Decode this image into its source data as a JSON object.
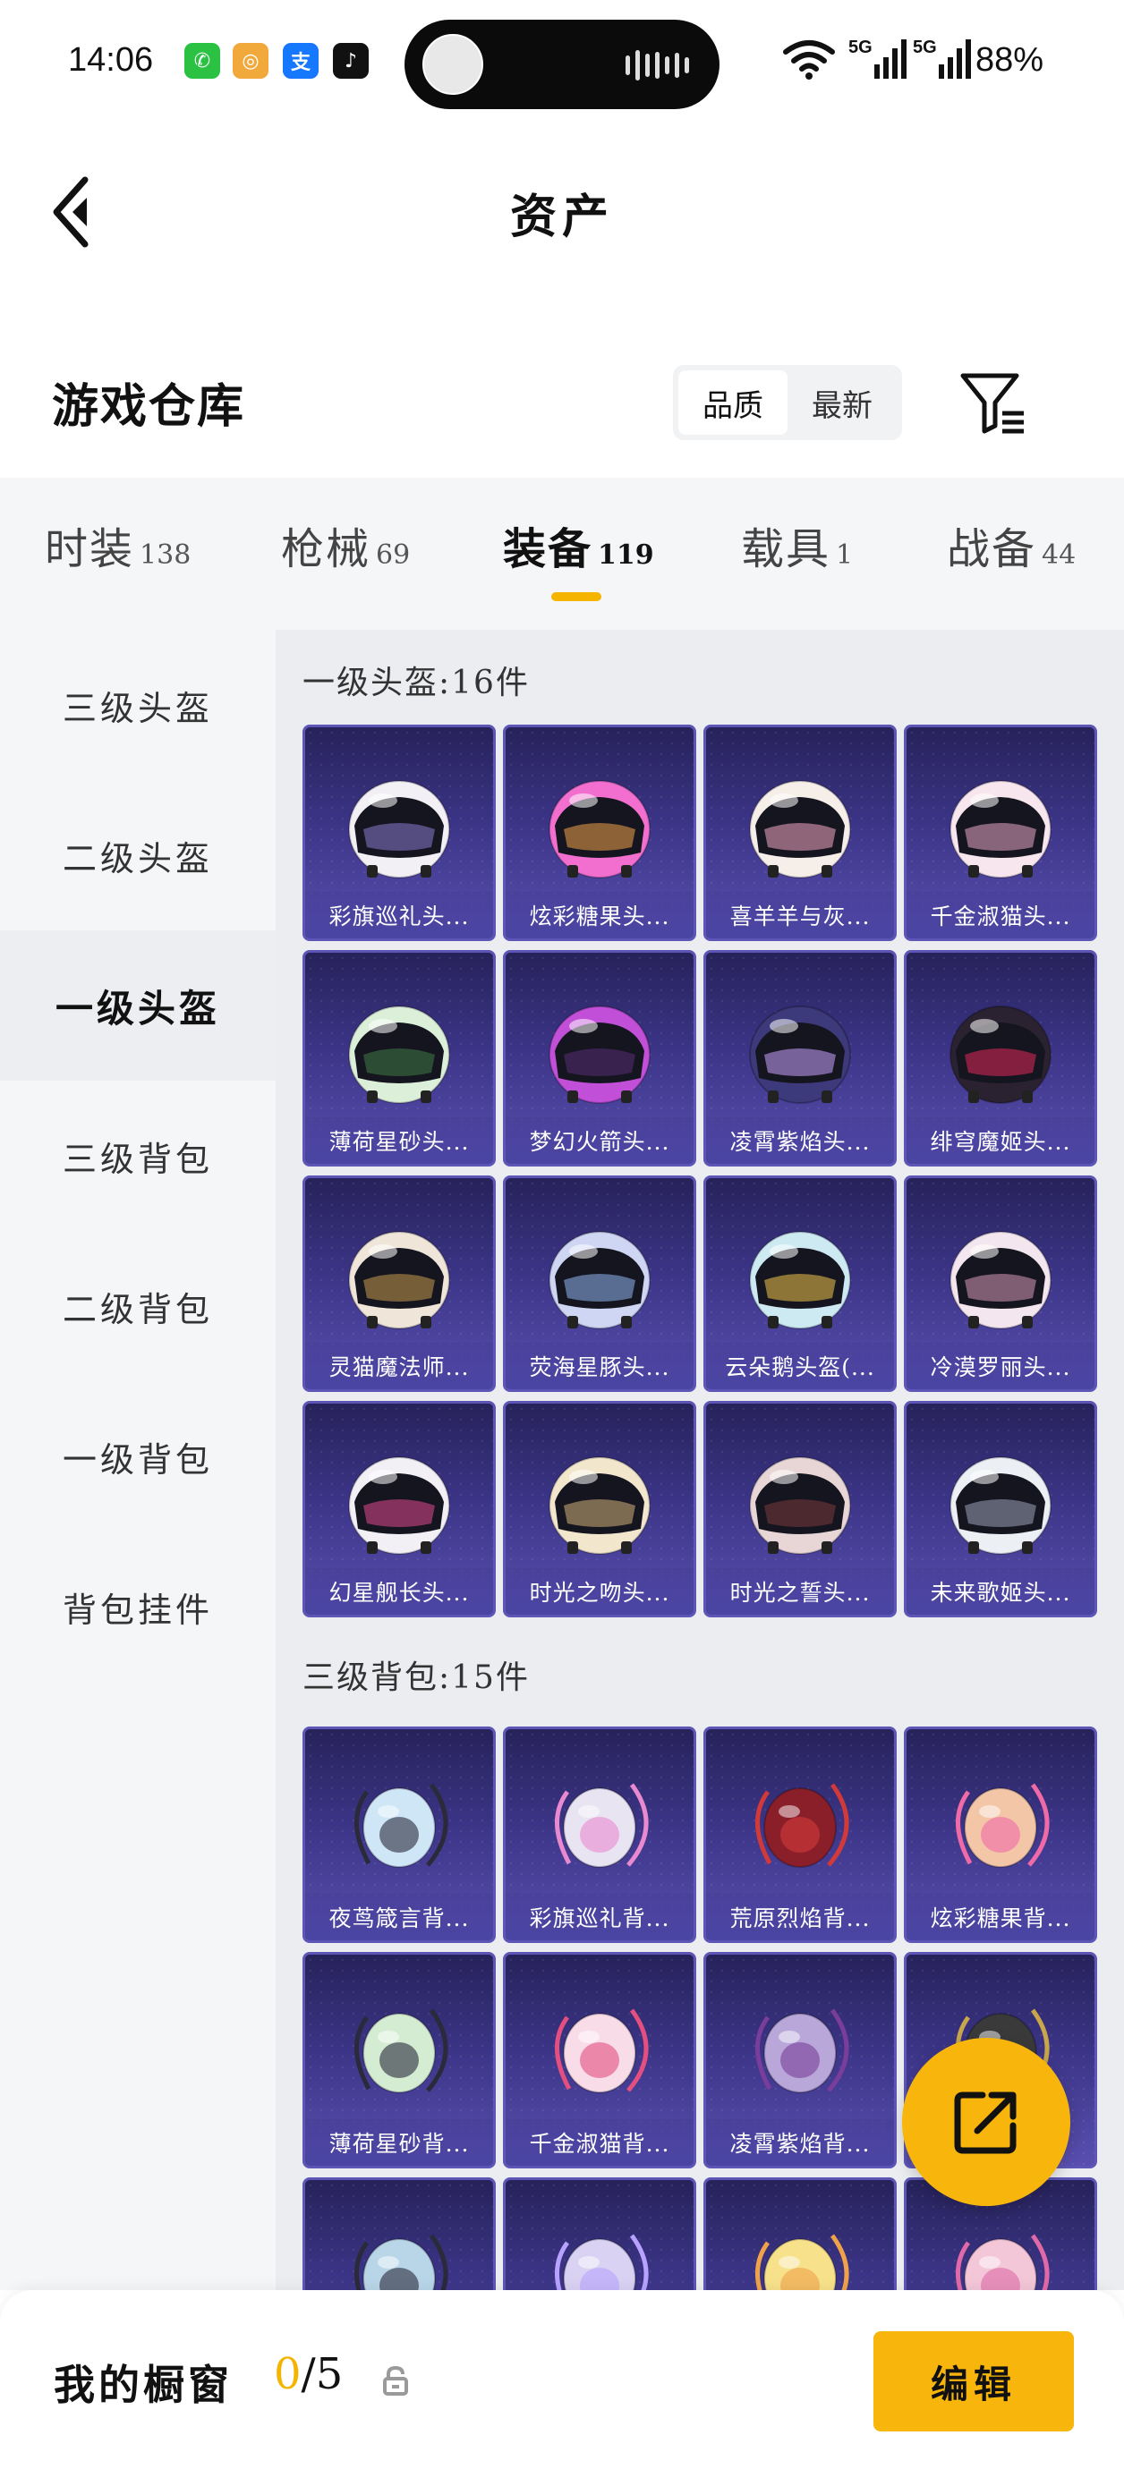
{
  "status_bar": {
    "time": "14:06",
    "apps": [
      {
        "name": "wechat-icon",
        "glyph": "✆",
        "color": "#2bc244"
      },
      {
        "name": "music-app-icon",
        "glyph": "◎",
        "color": "#f2a93b"
      },
      {
        "name": "alipay-icon",
        "glyph": "支",
        "color": "#1677ff"
      },
      {
        "name": "tiktok-icon",
        "glyph": "♪",
        "color": "#111111"
      }
    ],
    "network_1": "5G",
    "network_2": "5G",
    "battery": "88%"
  },
  "header": {
    "title": "资产"
  },
  "warehouse": {
    "title": "游戏仓库",
    "sort_quality": "品质",
    "sort_latest": "最新"
  },
  "categories": [
    {
      "label": "时装",
      "count": "138"
    },
    {
      "label": "枪械",
      "count": "69"
    },
    {
      "label": "装备",
      "count": "119",
      "active": true
    },
    {
      "label": "载具",
      "count": "1"
    },
    {
      "label": "战备",
      "count": "44"
    }
  ],
  "sidebar": {
    "items": [
      {
        "label": "三级头盔"
      },
      {
        "label": "二级头盔"
      },
      {
        "label": "一级头盔",
        "active": true
      },
      {
        "label": "三级背包"
      },
      {
        "label": "二级背包"
      },
      {
        "label": "一级背包"
      },
      {
        "label": "背包挂件"
      }
    ]
  },
  "sections": [
    {
      "title": "一级头盔:16件",
      "items": [
        {
          "name": "彩旗巡礼头...",
          "kind": "helmet",
          "color": "#f2f0f5",
          "accent": "#8a7bd0"
        },
        {
          "name": "炫彩糖果头...",
          "kind": "helmet",
          "color": "#f26fd0",
          "accent": "#f0a24a"
        },
        {
          "name": "喜羊羊与灰...",
          "kind": "helmet",
          "color": "#f6eee8",
          "accent": "#f2a7c2"
        },
        {
          "name": "千金淑猫头...",
          "kind": "helmet",
          "color": "#f7e6ee",
          "accent": "#e9a7c9"
        },
        {
          "name": "薄荷星砂头...",
          "kind": "helmet",
          "color": "#dcefd9",
          "accent": "#3f7a45"
        },
        {
          "name": "梦幻火箭头...",
          "kind": "helmet",
          "color": "#c24fd8",
          "accent": "#5a2e75"
        },
        {
          "name": "凌霄紫焰头...",
          "kind": "helmet",
          "color": "#3c3a7a",
          "accent": "#c9a3ff"
        },
        {
          "name": "绯穹魔姬头...",
          "kind": "helmet",
          "color": "#2a2230",
          "accent": "#e0285a"
        },
        {
          "name": "灵猫魔法师...",
          "kind": "helmet",
          "color": "#efe6d9",
          "accent": "#c79a4c"
        },
        {
          "name": "荧海星豚头...",
          "kind": "helmet",
          "color": "#cfd6f3",
          "accent": "#8fb7ef"
        },
        {
          "name": "云朵鹅头盔(...",
          "kind": "helmet",
          "color": "#cdeaf3",
          "accent": "#f0c24a"
        },
        {
          "name": "冷漠罗丽头...",
          "kind": "helmet",
          "color": "#f3e6ee",
          "accent": "#d79ab8"
        },
        {
          "name": "幻星舰长头...",
          "kind": "helmet",
          "color": "#f2f0f5",
          "accent": "#e04a8f"
        },
        {
          "name": "时光之吻头...",
          "kind": "helmet",
          "color": "#f2e6cc",
          "accent": "#d4b27a"
        },
        {
          "name": "时光之誓头...",
          "kind": "helmet",
          "color": "#e8d6d6",
          "accent": "#7a3a3a"
        },
        {
          "name": "未来歌姬头...",
          "kind": "helmet",
          "color": "#eceff4",
          "accent": "#9aa2b8"
        }
      ]
    },
    {
      "title": "三级背包:15件",
      "items": [
        {
          "name": "夜茑箴言背...",
          "kind": "bag",
          "color": "#cfe6f6",
          "accent": "#2a2a3a"
        },
        {
          "name": "彩旗巡礼背...",
          "kind": "bag",
          "color": "#e9e4f2",
          "accent": "#e98ad0"
        },
        {
          "name": "荒原烈焰背...",
          "kind": "bag",
          "color": "#8a1f2a",
          "accent": "#d23a3a"
        },
        {
          "name": "炫彩糖果背...",
          "kind": "bag",
          "color": "#f3c6a8",
          "accent": "#f06aa8"
        },
        {
          "name": "薄荷星砂背...",
          "kind": "bag",
          "color": "#d4ecd2",
          "accent": "#2a2a3a"
        },
        {
          "name": "千金淑猫背...",
          "kind": "bag",
          "color": "#f8dde8",
          "accent": "#e34f7f"
        },
        {
          "name": "凌霄紫焰背...",
          "kind": "bag",
          "color": "#b8a7d8",
          "accent": "#7a3e9a"
        },
        {
          "name": "",
          "kind": "bag",
          "color": "#3a3a3a",
          "accent": "#c9a64a"
        },
        {
          "name": "",
          "kind": "bag",
          "color": "#b8d6e8",
          "accent": "#2a2a3a"
        },
        {
          "name": "",
          "kind": "bag",
          "color": "#d9d2f3",
          "accent": "#b7a3ff"
        },
        {
          "name": "",
          "kind": "bag",
          "color": "#f7e18a",
          "accent": "#f0a24a"
        },
        {
          "name": "",
          "kind": "bag",
          "color": "#f3c6d8",
          "accent": "#e06aa8"
        }
      ]
    }
  ],
  "showcase": {
    "label": "我的橱窗",
    "current": "0",
    "total": "/5",
    "edit_label": "编辑"
  }
}
